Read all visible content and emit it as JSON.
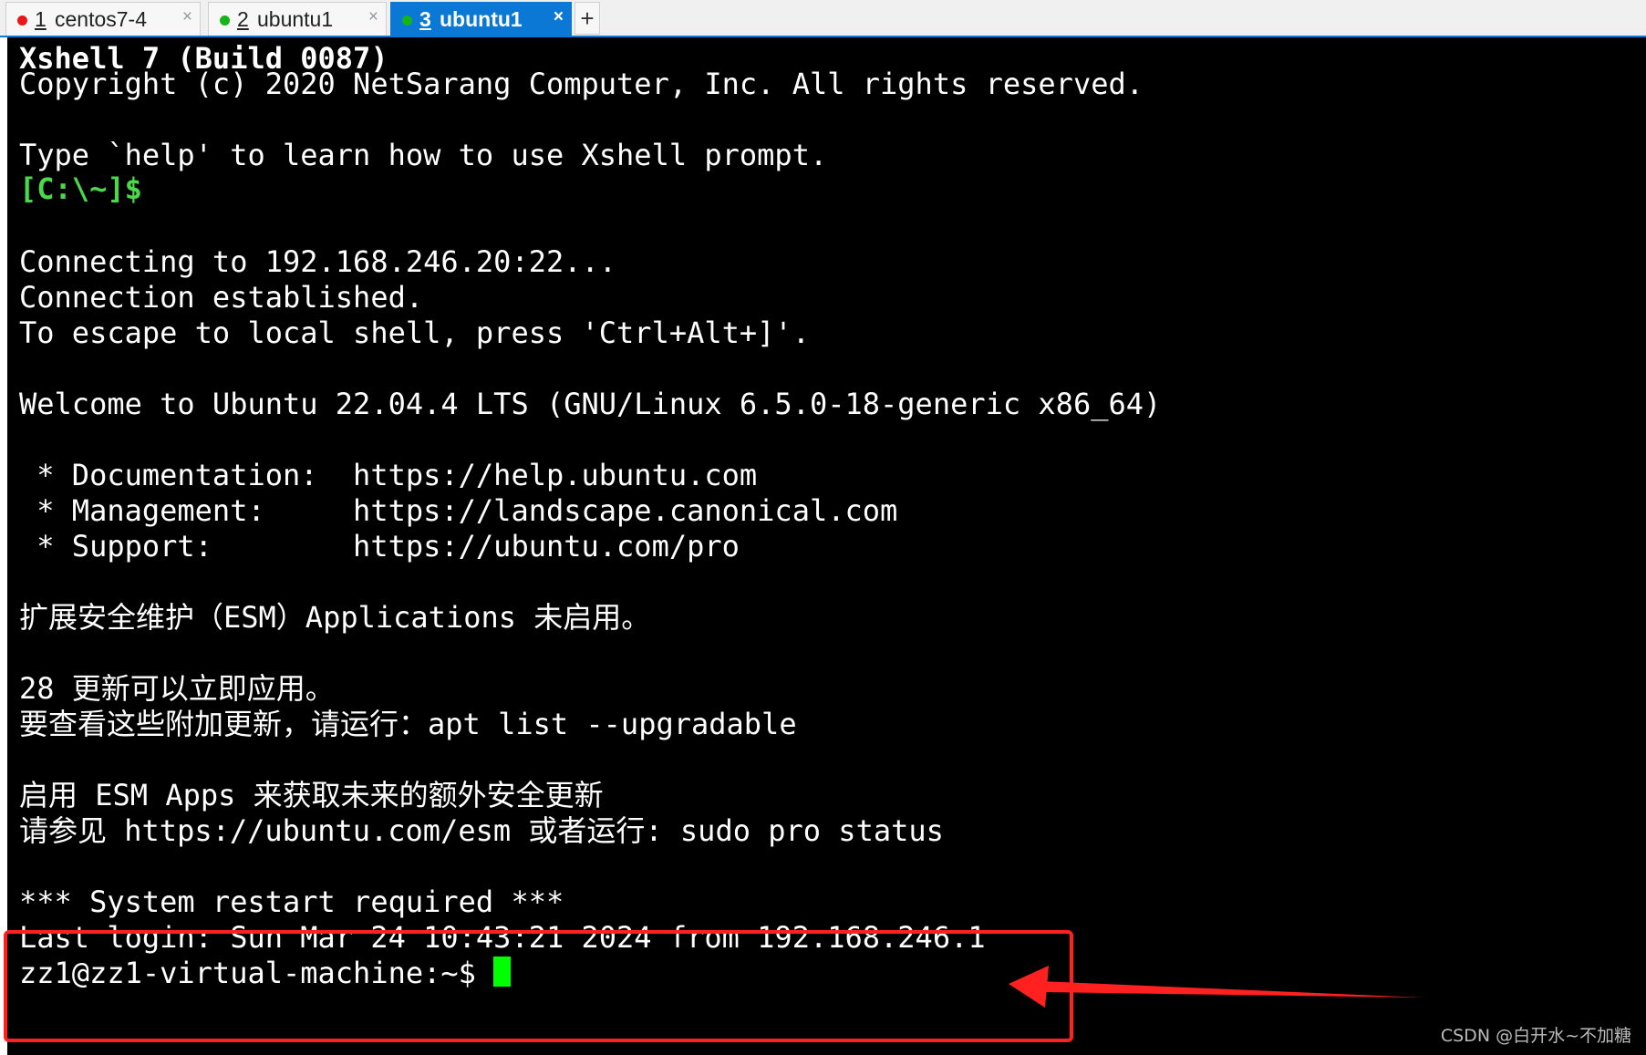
{
  "tabs": [
    {
      "number": "1",
      "name": "centos7-4",
      "status_color": "#e81818",
      "close": "×",
      "active": false
    },
    {
      "number": "2",
      "name": "ubuntu1",
      "status_color": "#16b416",
      "close": "×",
      "active": false
    },
    {
      "number": "3",
      "name": "ubuntu1",
      "status_color": "#16b416",
      "close": "×",
      "active": true
    }
  ],
  "new_tab_label": "+",
  "terminal": {
    "lines": [
      "Xshell 7 (Build 0087)",
      "Copyright (c) 2020 NetSarang Computer, Inc. All rights reserved.",
      "Type `help' to learn how to use Xshell prompt.",
      "[C:\\~]$",
      "Connecting to 192.168.246.20:22...",
      "Connection established.",
      "To escape to local shell, press 'Ctrl+Alt+]'.",
      "Welcome to Ubuntu 22.04.4 LTS (GNU/Linux 6.5.0-18-generic x86_64)",
      " * Documentation:  https://help.ubuntu.com",
      " * Management:     https://landscape.canonical.com",
      " * Support:        https://ubuntu.com/pro",
      "扩展安全维护（ESM）Applications 未启用。",
      "28 更新可以立即应用。",
      "要查看这些附加更新，请运行：apt list --upgradable",
      "启用 ESM Apps 来获取未来的额外安全更新",
      "请参见 https://ubuntu.com/esm 或者运行: sudo pro status",
      "*** System restart required ***",
      "Last login: Sun Mar 24 10:43:21 2024 from 192.168.246.1",
      "zz1@zz1-virtual-machine:~$ "
    ],
    "prompt_color": "#4bd84b",
    "cursor_color": "#00ff00"
  },
  "annotation": {
    "color": "#ff2020"
  },
  "watermark": "CSDN @白开水~不加糖"
}
